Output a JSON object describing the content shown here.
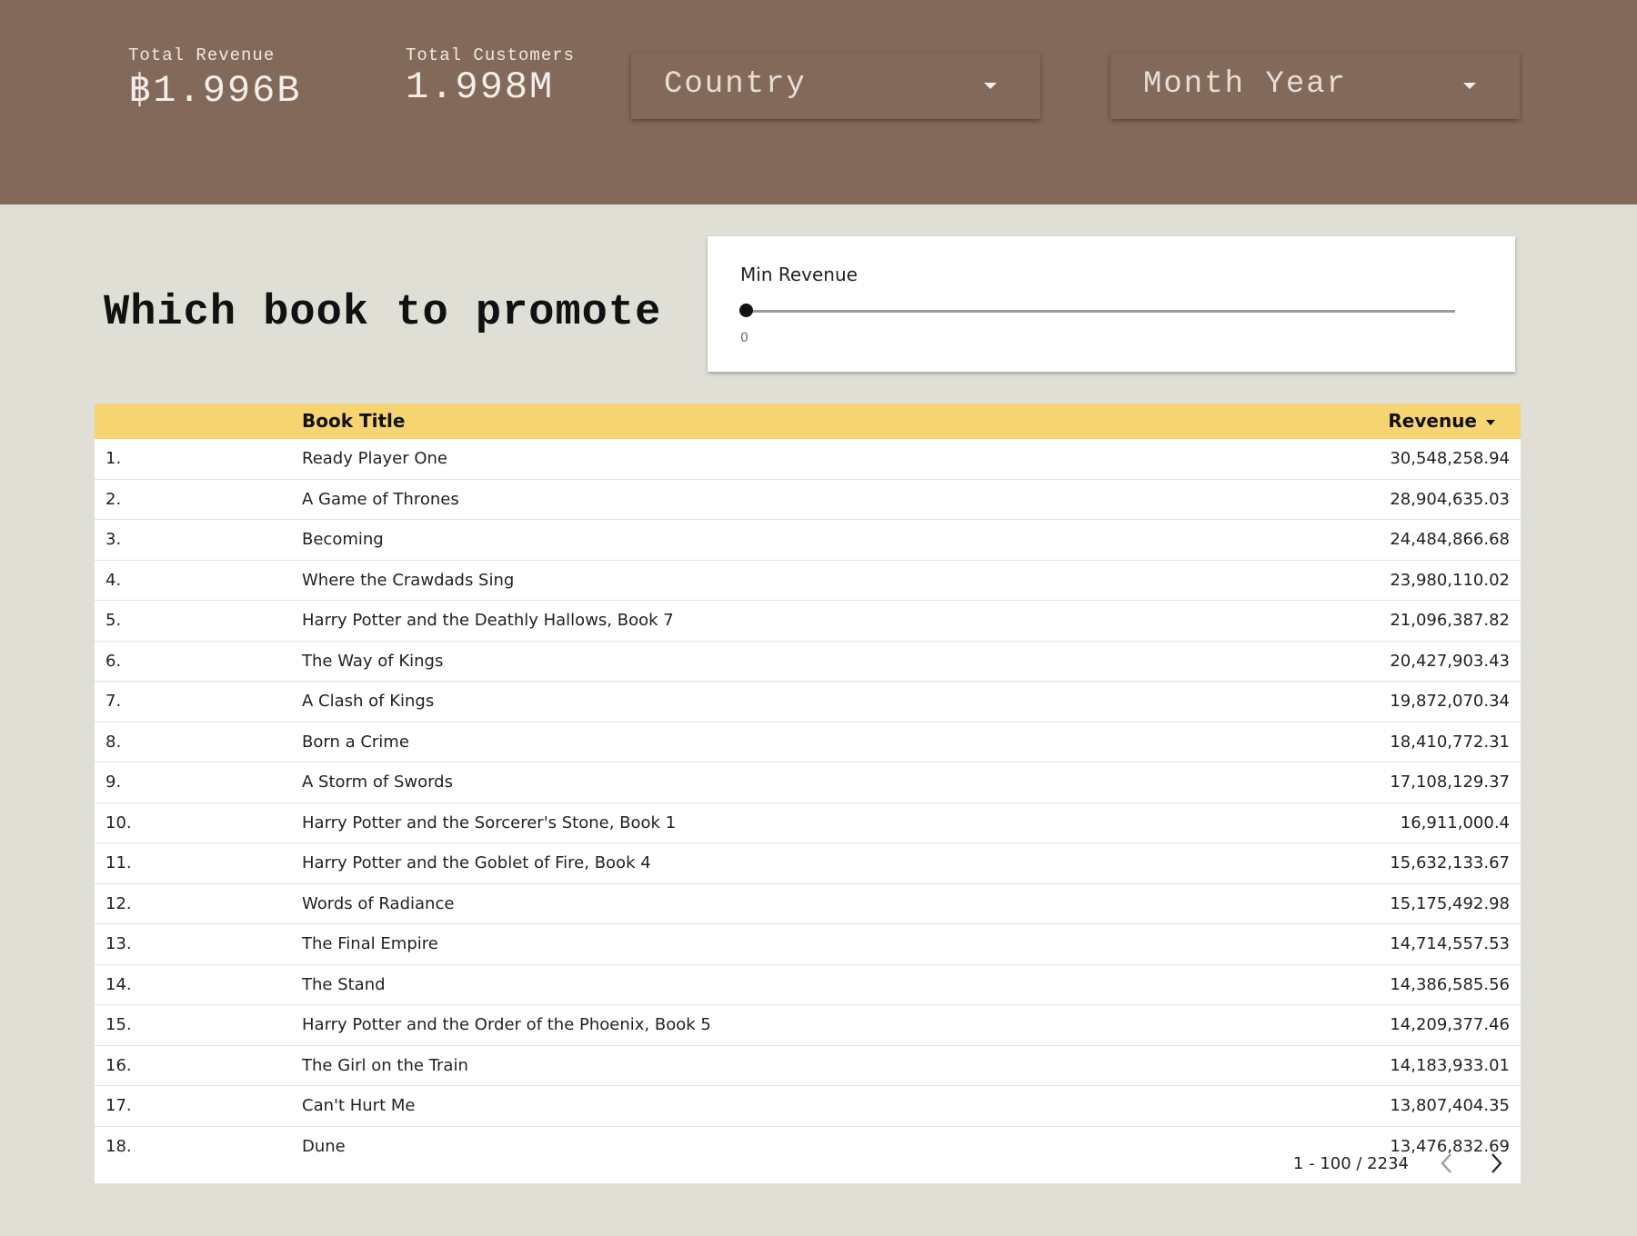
{
  "kpis": {
    "revenue": {
      "label": "Total Revenue",
      "value": "฿1.996B"
    },
    "customers": {
      "label": "Total Customers",
      "value": "1.998M"
    }
  },
  "filters": {
    "country": {
      "label": "Country"
    },
    "month_year": {
      "label": "Month Year"
    }
  },
  "page": {
    "title": "Which book to promote"
  },
  "slider": {
    "label": "Min Revenue",
    "value": "0"
  },
  "table": {
    "headers": {
      "title": "Book Title",
      "revenue": "Revenue"
    },
    "rows": [
      {
        "idx": "1.",
        "title": "Ready Player One",
        "revenue": "30,548,258.94"
      },
      {
        "idx": "2.",
        "title": "A Game of Thrones",
        "revenue": "28,904,635.03"
      },
      {
        "idx": "3.",
        "title": "Becoming",
        "revenue": "24,484,866.68"
      },
      {
        "idx": "4.",
        "title": "Where the Crawdads Sing",
        "revenue": "23,980,110.02"
      },
      {
        "idx": "5.",
        "title": "Harry Potter and the Deathly Hallows, Book 7",
        "revenue": "21,096,387.82"
      },
      {
        "idx": "6.",
        "title": "The Way of Kings",
        "revenue": "20,427,903.43"
      },
      {
        "idx": "7.",
        "title": "A Clash of Kings",
        "revenue": "19,872,070.34"
      },
      {
        "idx": "8.",
        "title": "Born a Crime",
        "revenue": "18,410,772.31"
      },
      {
        "idx": "9.",
        "title": "A Storm of Swords",
        "revenue": "17,108,129.37"
      },
      {
        "idx": "10.",
        "title": "Harry Potter and the Sorcerer's Stone, Book 1",
        "revenue": "16,911,000.4"
      },
      {
        "idx": "11.",
        "title": "Harry Potter and the Goblet of Fire, Book 4",
        "revenue": "15,632,133.67"
      },
      {
        "idx": "12.",
        "title": "Words of Radiance",
        "revenue": "15,175,492.98"
      },
      {
        "idx": "13.",
        "title": "The Final Empire",
        "revenue": "14,714,557.53"
      },
      {
        "idx": "14.",
        "title": "The Stand",
        "revenue": "14,386,585.56"
      },
      {
        "idx": "15.",
        "title": "Harry Potter and the Order of the Phoenix, Book 5",
        "revenue": "14,209,377.46"
      },
      {
        "idx": "16.",
        "title": "The Girl on the Train",
        "revenue": "14,183,933.01"
      },
      {
        "idx": "17.",
        "title": "Can't Hurt Me",
        "revenue": "13,807,404.35"
      },
      {
        "idx": "18.",
        "title": "Dune",
        "revenue": "13,476,832.69"
      }
    ],
    "pagination": "1 - 100 / 2234"
  },
  "colors": {
    "header_bg": "#83695a",
    "page_bg": "#e0dfd6",
    "table_header_bg": "#f6d472"
  },
  "icons": {
    "dropdown": "caret-down-icon",
    "sort": "sort-desc-icon",
    "prev": "chevron-left-icon",
    "next": "chevron-right-icon"
  }
}
